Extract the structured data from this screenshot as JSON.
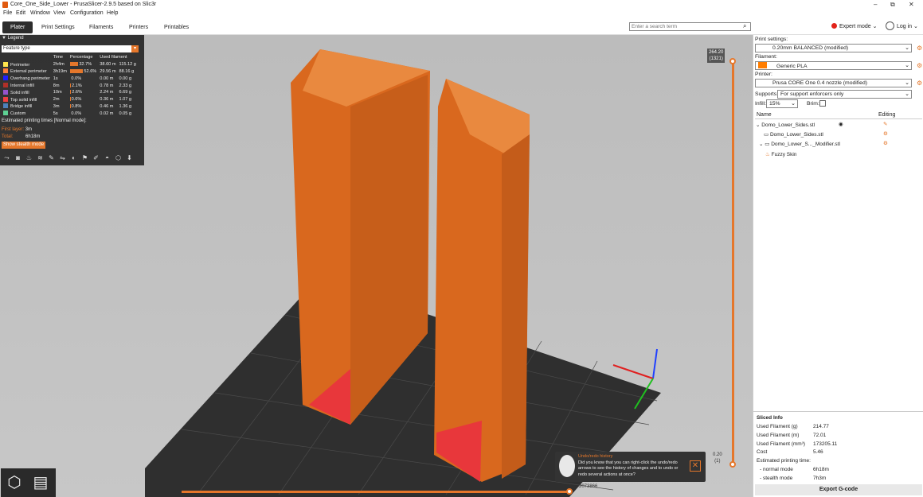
{
  "window": {
    "title": "Core_One_Side_Lower - PrusaSlicer-2.9.5 based on Slic3r",
    "controls": [
      "–",
      "⧉",
      "✕"
    ]
  },
  "menu": [
    "File",
    "Edit",
    "Window",
    "View",
    "Configuration",
    "Help"
  ],
  "tabs": [
    "Plater",
    "Print Settings",
    "Filaments",
    "Printers",
    "Printables"
  ],
  "search": {
    "placeholder": "Enter a search term"
  },
  "mode": {
    "label": "Expert mode"
  },
  "login": {
    "label": "Log in"
  },
  "legend": {
    "title": "Legend",
    "feature_label": "Feature type",
    "columns": [
      "Time",
      "Percentage",
      "Used filament"
    ],
    "rows": [
      {
        "name": "Perimeter",
        "color": "#ffe64d",
        "time": "2h4m",
        "pct": "32.7%",
        "pct_value": 32.7,
        "len": "38.60 m",
        "weight": "115.12 g"
      },
      {
        "name": "External perimeter",
        "color": "#ff7d38",
        "time": "3h19m",
        "pct": "52.6%",
        "pct_value": 52.6,
        "len": "29.56 m",
        "weight": "88.16 g"
      },
      {
        "name": "Overhang perimeter",
        "color": "#1f1fff",
        "time": "1s",
        "pct": "0.0%",
        "pct_value": 0,
        "len": "0.00 m",
        "weight": "0.00 g"
      },
      {
        "name": "Internal infill",
        "color": "#b03029",
        "time": "8m",
        "pct": "2.1%",
        "pct_value": 2.1,
        "len": "0.78 m",
        "weight": "2.33 g"
      },
      {
        "name": "Solid infill",
        "color": "#9654cc",
        "time": "10m",
        "pct": "2.6%",
        "pct_value": 2.6,
        "len": "2.24 m",
        "weight": "6.69 g"
      },
      {
        "name": "Top solid infill",
        "color": "#f04040",
        "time": "2m",
        "pct": "0.6%",
        "pct_value": 0.6,
        "len": "0.36 m",
        "weight": "1.07 g"
      },
      {
        "name": "Bridge infill",
        "color": "#4d80ba",
        "time": "3m",
        "pct": "0.8%",
        "pct_value": 0.8,
        "len": "0.46 m",
        "weight": "1.36 g"
      },
      {
        "name": "Custom",
        "color": "#5ed194",
        "time": "5s",
        "pct": "0.0%",
        "pct_value": 0,
        "len": "0.02 m",
        "weight": "0.05 g"
      }
    ],
    "note": "Estimated printing times [Normal mode]:",
    "first_layer_label": "First layer:",
    "first_layer": "3m",
    "total_label": "Total:",
    "total": "6h18m",
    "stealth_btn": "Show stealth mode"
  },
  "slider": {
    "top": "264.20",
    "top_sub": "(1321)",
    "bottom": "0.20",
    "bottom_sub": "(1)",
    "horizontal": "2073866"
  },
  "tip": {
    "title": "Undo/redo history",
    "text": "Did you know that you can right-click the undo/redo arrows to see the history of changes and to undo or redo several actions at once?"
  },
  "right": {
    "print_settings_label": "Print settings:",
    "print_settings": "0.20mm BALANCED (modified)",
    "filament_label": "Filament:",
    "filament": "Generic PLA",
    "filament_color": "#ff7d00",
    "printer_label": "Printer:",
    "printer": "Prusa CORE One 0.4 nozzle (modified)",
    "supports_label": "Supports:",
    "supports": "For support enforcers only",
    "infill_label": "Infill:",
    "infill": "15%",
    "brim_label": "Brim:",
    "col_name": "Name",
    "col_editing": "Editing",
    "objects": [
      "Domo_Lower_Sides.stl",
      "Domo_Lower_Sides.stl",
      "Domo_Lower_S..._Modifier.stl",
      "Fuzzy Skin"
    ]
  },
  "sliced": {
    "title": "Sliced Info",
    "rows": [
      {
        "label": "Used Filament (g)",
        "value": "214.77"
      },
      {
        "label": "Used Filament (m)",
        "value": "72.01"
      },
      {
        "label": "Used Filament (mm³)",
        "value": "173205.11"
      },
      {
        "label": "Cost",
        "value": "5.46"
      },
      {
        "label": "Estimated printing time:",
        "value": ""
      },
      {
        "label": "- normal mode",
        "value": "6h18m"
      },
      {
        "label": "- stealth mode",
        "value": "7h3m"
      }
    ],
    "export": "Export G-code"
  }
}
